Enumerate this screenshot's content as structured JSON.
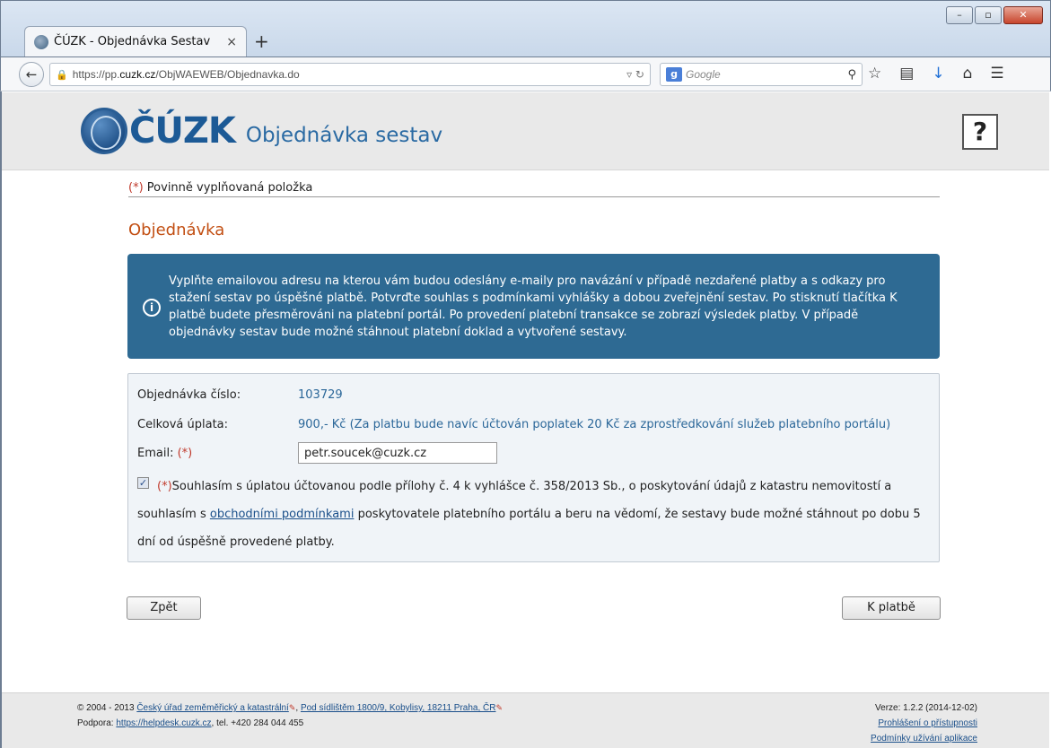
{
  "browser": {
    "tab_title": "ČÚZK - Objednávka Sestav",
    "tab_close": "×",
    "new_tab": "+",
    "url_host_prefix": "https://pp.",
    "url_host_bold": "cuzk.cz",
    "url_path": "/ObjWAEWEB/Objednavka.do",
    "search_placeholder": "Google",
    "window_buttons": [
      "–",
      "▫",
      "✕"
    ]
  },
  "header": {
    "logo_text": "ČÚZK",
    "app_title": "Objednávka sestav",
    "help_label": "?"
  },
  "required_note": {
    "mark": "(*)",
    "text": "Povinně vyplňovaná položka"
  },
  "section_title": "Objednávka",
  "info": {
    "text": "Vyplňte emailovou adresu na kterou vám budou odeslány e-maily pro navázání v případě nezdařené platby a s odkazy pro stažení sestav po úspěšné platbě. Potvrďte souhlas s podmínkami vyhlášky a dobou zveřejnění sestav. Po stisknutí tlačítka K platbě budete přesměrováni na platební portál. Po provedení platební transakce se zobrazí výsledek platby. V případě objednávky sestav bude možné stáhnout platební doklad a vytvořené sestavy."
  },
  "form": {
    "order_label": "Objednávka číslo:",
    "order_value": "103729",
    "total_label": "Celková úplata:",
    "total_value": "900,- Kč (Za platbu bude navíc účtován poplatek 20 Kč za zprostředkování služeb platebního portálu)",
    "email_label": "Email:",
    "email_required": "(*)",
    "email_value": "petr.soucek@cuzk.cz",
    "consent_checked": true,
    "consent_required": "(*)",
    "consent_text_1": "Souhlasím s úplatou účtovanou podle přílohy č. 4 k vyhlášce č. 358/2013 Sb., o poskytování údajů z katastru nemovitostí a souhlasím s ",
    "consent_link": "obchodními podmínkami",
    "consent_text_2": " poskytovatele platebního portálu a beru na vědomí, že sestavy bude možné stáhnout po dobu 5 dní od úspěšně provedené platby."
  },
  "buttons": {
    "back": "Zpět",
    "pay": "K platbě"
  },
  "footer": {
    "copyright": "© 2004 - 2013",
    "org_link": "Český úřad zeměměřický a katastrální",
    "address_link": "Pod sídlištěm 1800/9, Kobylisy, 18211 Praha, ČR",
    "support_label": "Podpora:",
    "support_link": "https://helpdesk.cuzk.cz",
    "phone": ", tel. +420 284 044 455",
    "version": "Verze: 1.2.2 (2014-12-02)",
    "accessibility_link": "Prohlášení o přístupnosti",
    "terms_link": "Podmínky užívání aplikace"
  },
  "colors": {
    "info_bg": "#2e6a93",
    "section_title": "#c24f13",
    "value_text": "#2b6799",
    "required_mark": "#c0392b"
  }
}
